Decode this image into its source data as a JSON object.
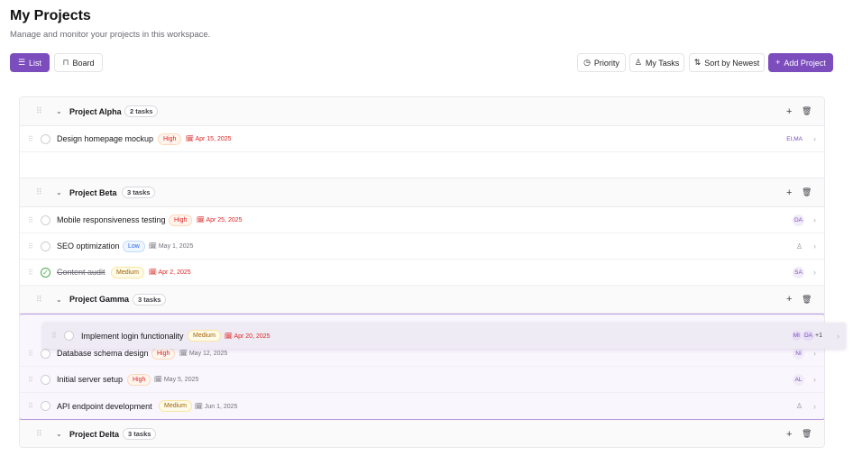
{
  "header": {
    "title": "My Projects",
    "subtitle": "Manage and monitor your projects in this workspace."
  },
  "toolbar": {
    "view_list": "List",
    "view_board": "Board",
    "priority": "Priority",
    "my_tasks": "My Tasks",
    "sort": "Sort by Newest",
    "add_project": "Add Project"
  },
  "icons": {
    "list": "list-icon",
    "board": "board-icon",
    "priority": "clock-icon",
    "my_tasks": "user-icon",
    "sort": "sort-icon",
    "add": "plus-icon",
    "delete": "trash-icon",
    "collapse": "chevron-down-icon",
    "calendar": "calendar-icon",
    "drag": "drag-handle-icon"
  },
  "colors": {
    "accent": "#7c4dbd",
    "high": "#dc2626",
    "medium": "#a16207",
    "low": "#2563eb",
    "done": "#4cae4f"
  },
  "groups": [
    {
      "name": "Project Alpha",
      "count": "2 tasks",
      "tasks": [
        {
          "name": "Design homepage mockup",
          "priority": "High",
          "due": "Apr 15, 2025",
          "assignee": "EI,MA"
        }
      ]
    },
    {
      "name": "Project Beta",
      "count": "3 tasks",
      "tasks": [
        {
          "name": "Mobile responsiveness testing",
          "priority": "High",
          "due": "Apr 25, 2025",
          "assignee": "DA"
        },
        {
          "name": "SEO optimization",
          "priority": "Low",
          "due": "May 1, 2025",
          "assignee": ""
        },
        {
          "name": "Content audit",
          "priority": "Medium",
          "due": "Apr 2, 2025",
          "assignee": "SA",
          "done": true
        }
      ]
    },
    {
      "name": "Project Gamma",
      "count": "3 tasks",
      "tasks": [
        {
          "name": "Database schema design",
          "priority": "High",
          "due": "May 12, 2025",
          "assignee": "NI"
        },
        {
          "name": "Initial server setup",
          "priority": "High",
          "due": "May 5, 2025",
          "assignee": "AL"
        },
        {
          "name": "API endpoint development",
          "priority": "Medium",
          "due": "Jun 1, 2025",
          "assignee": ""
        }
      ]
    },
    {
      "name": "Project Delta",
      "count": "3 tasks",
      "tasks": []
    }
  ],
  "dragging": {
    "name": "Implement login functionality",
    "priority": "Medium",
    "due": "Apr 20, 2025",
    "assignees": [
      "MI",
      "DA"
    ],
    "extra": "+1"
  }
}
